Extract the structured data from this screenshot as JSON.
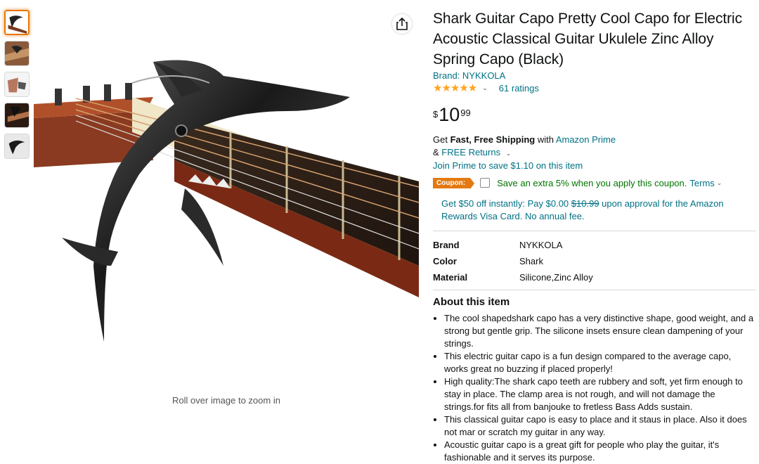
{
  "gallery": {
    "thumbnails": [
      "thumbnail-1",
      "thumbnail-2",
      "thumbnail-3",
      "thumbnail-4",
      "thumbnail-5"
    ],
    "zoom_hint": "Roll over image to zoom in"
  },
  "product": {
    "title": "Shark Guitar Capo Pretty Cool Capo for Electric Acoustic Classical Guitar Ukulele Zinc Alloy Spring Capo (Black)",
    "brand_link": "Brand: NYKKOLA",
    "stars": "★★★★★",
    "rating_value": 4.6,
    "ratings_count": "61 ratings",
    "price": {
      "symbol": "$",
      "whole": "10",
      "fraction": "99"
    }
  },
  "shipping": {
    "get": "Get ",
    "fast_free": "Fast, Free Shipping",
    "with": " with ",
    "prime_link": "Amazon Prime",
    "amp": "& ",
    "free_returns": "FREE Returns",
    "join_prime": "Join Prime to save $1.10 on this item"
  },
  "coupon": {
    "badge": "Coupon:",
    "text": "Save an extra 5% when you apply this coupon.",
    "terms": "Terms"
  },
  "card_offer": {
    "part1": "Get $50 off instantly: Pay $0.00 ",
    "strike": "$10.99",
    "part2": " upon approval for the Amazon Rewards Visa Card. No annual fee."
  },
  "specs": [
    {
      "key": "Brand",
      "value": "NYKKOLA"
    },
    {
      "key": "Color",
      "value": "Shark"
    },
    {
      "key": "Material",
      "value": "Silicone,Zinc Alloy"
    }
  ],
  "about": {
    "title": "About this item",
    "bullets": [
      "The cool shapedshark capo has a very distinctive shape, good weight, and a strong but gentle grip. The silicone insets ensure clean dampening of your strings.",
      "This electric guitar capo is a fun design compared to the average capo, works great no buzzing if placed properly!",
      "High quality:The shark capo teeth are rubbery and soft, yet firm enough to stay in place. The clamp area is not rough, and will not damage the strings.for fits all from banjouke to fretless Bass Adds sustain.",
      "This classical guitar capo is easy to place and it staus in place. Also it does not mar or scratch my guitar in any way.",
      "Acoustic guitar capo is a great gift for people who play the guitar, it's fashionable and it serves its purpose."
    ]
  },
  "icons": {
    "share": "share-icon",
    "chevron": "chevron-down-icon"
  },
  "colors": {
    "link": "#007185",
    "coupon_badge": "#E47911",
    "coupon_text": "#007600",
    "star": "#FFA41C"
  }
}
